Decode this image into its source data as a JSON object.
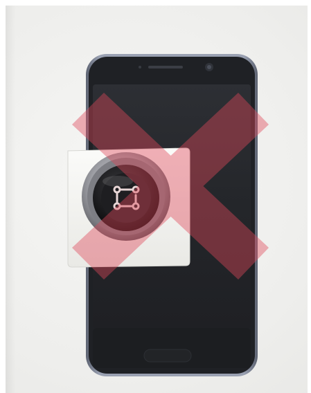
{
  "scene": {
    "subject": "smartphone-with-magnetic-mount",
    "colors": {
      "background": "#eeeeec",
      "phone_frame": "#8a90a0",
      "phone_screen": "#26282c",
      "mount_plate": "#f2f2ef",
      "mount_knob": "#1b1b1d",
      "mount_logo": "#e8d6d6",
      "overlay_cross": "#e0485a"
    },
    "icons": [
      "prohibited-cross-icon",
      "link-logo-icon"
    ]
  }
}
